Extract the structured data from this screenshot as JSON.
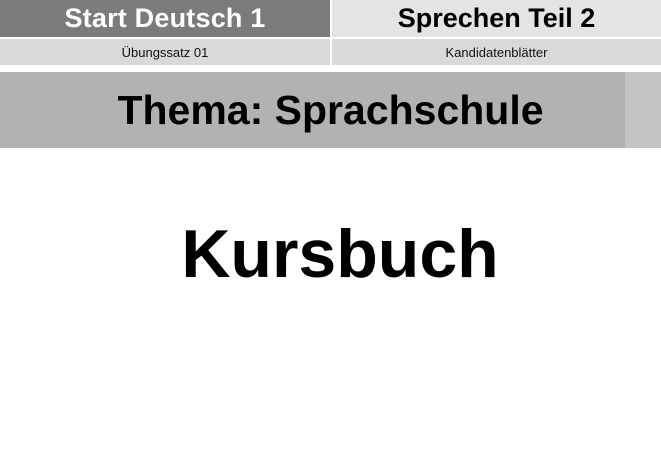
{
  "header": {
    "exam_title": "Start Deutsch 1",
    "section_title": "Sprechen Teil 2",
    "set_label": "Übungssatz 01",
    "sheet_label": "Kandidatenblätter"
  },
  "topic": {
    "title": "Thema: Sprachschule"
  },
  "card": {
    "keyword": "Kursbuch"
  },
  "colors": {
    "header_dark": "#7b7b7b",
    "header_light": "#e4e4e4",
    "subheader": "#d9d9d9",
    "topic_bar": "#b2b2b2"
  }
}
